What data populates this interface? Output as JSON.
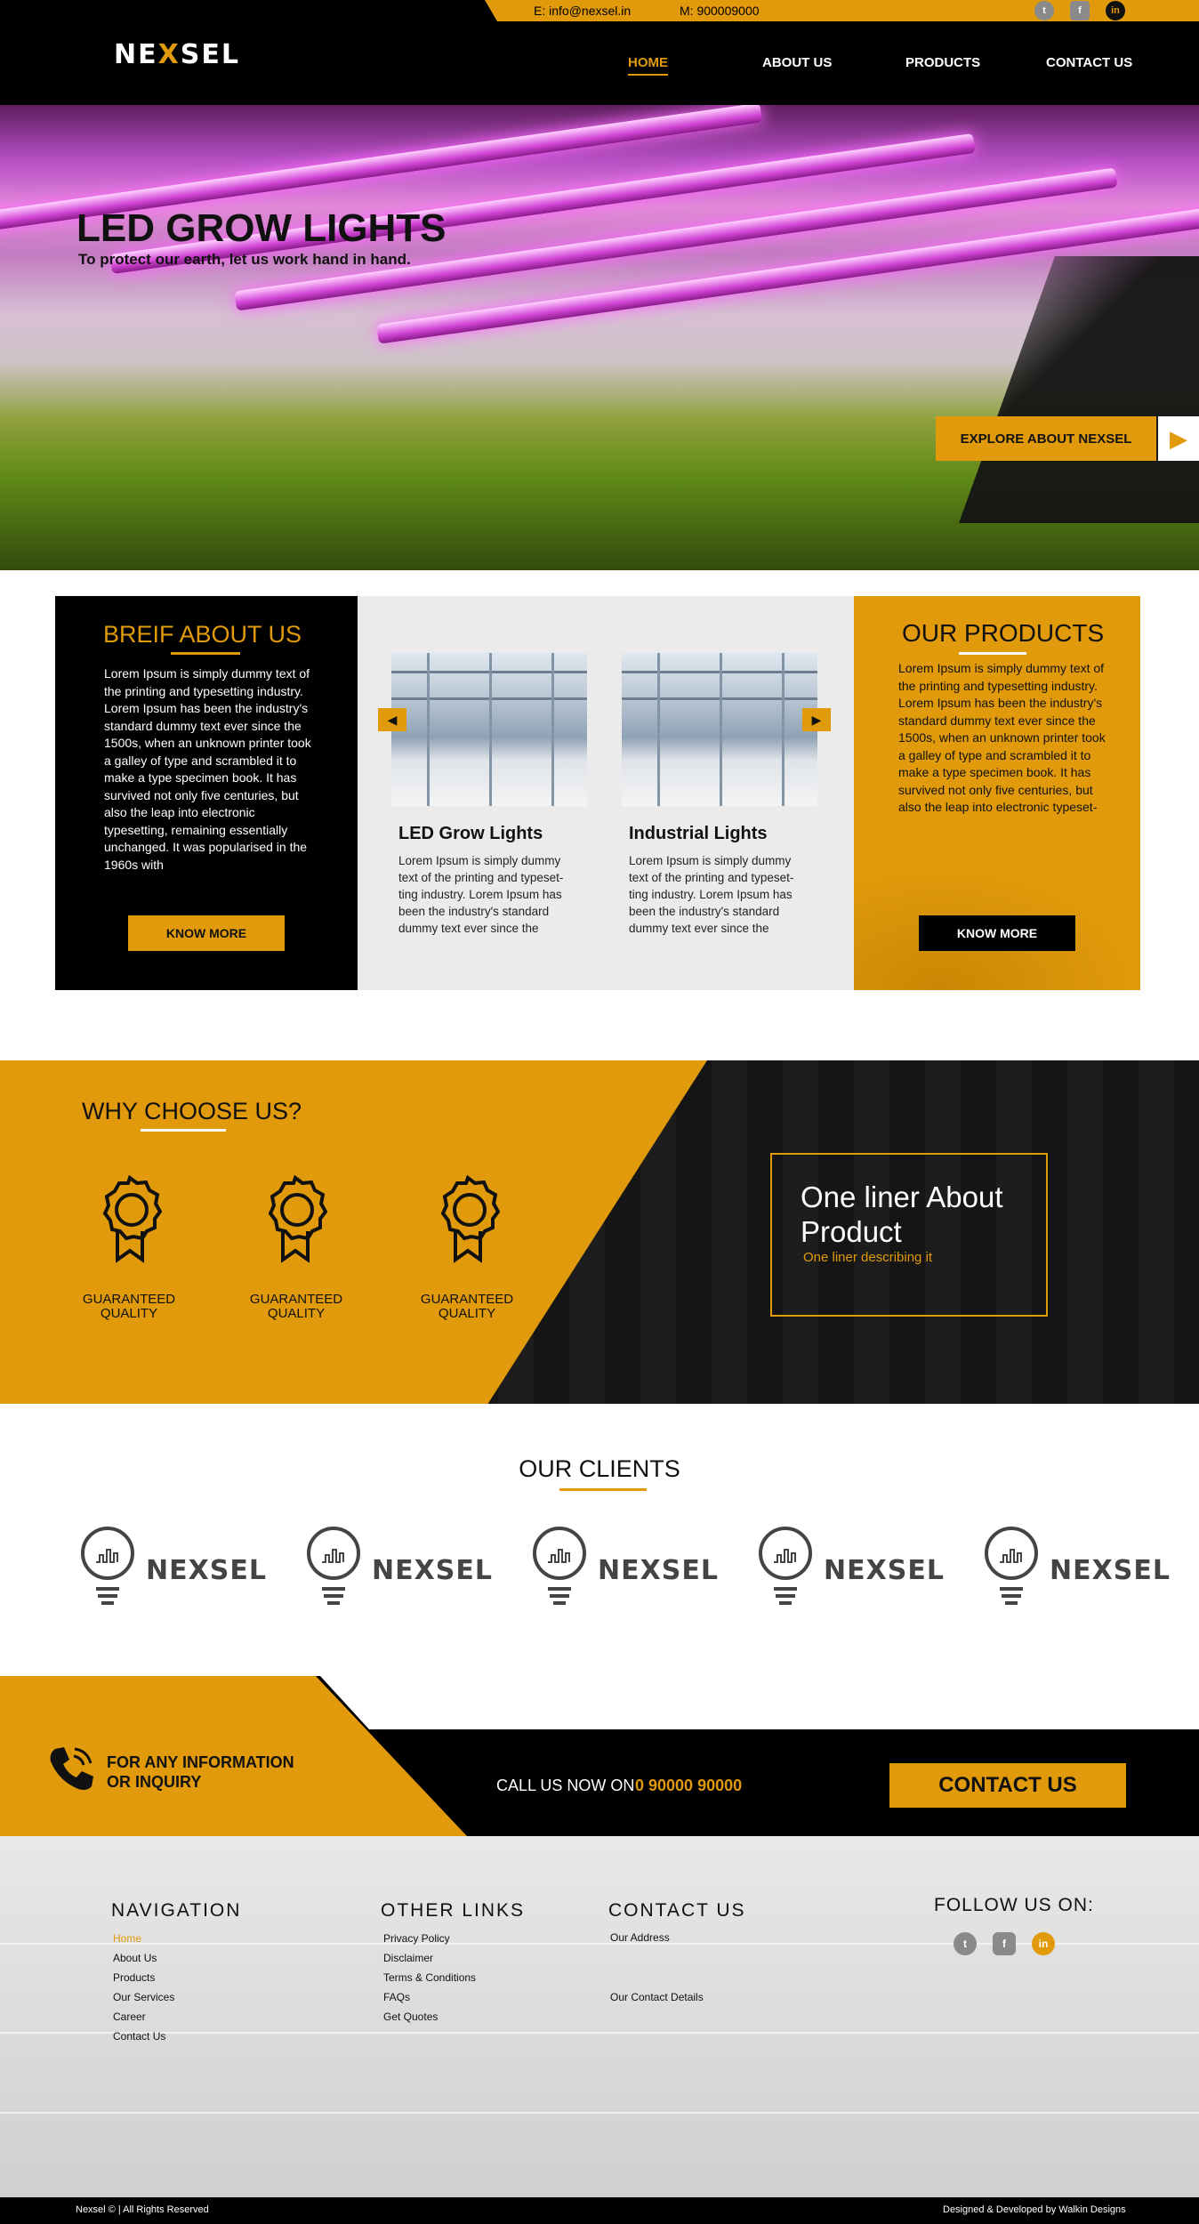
{
  "topbar": {
    "email": "E: info@nexsel.in",
    "phone": "M: 900009000"
  },
  "brand": {
    "logo_a": "NE",
    "logo_x": "X",
    "logo_b": "SEL"
  },
  "nav": {
    "home": "HOME",
    "about": "ABOUT US",
    "products": "PRODUCTS",
    "contact": "CONTACT US"
  },
  "hero": {
    "title": "LED GROW LIGHTS",
    "subtitle": "To protect our earth, let us work hand in hand.",
    "explore": "EXPLORE ABOUT NEXSEL"
  },
  "about": {
    "title": "BREIF ABOUT US",
    "text": "Lorem Ipsum is simply dummy text of the printing and typesetting industry. Lorem Ipsum has been the industry's standard dummy text ever since the 1500s, when an unknown printer took a galley of type and scrambled it to make a type specimen book. It has survived not only five centuries, but also the leap into electronic typesetting, remaining essentially unchanged. It was popularised in the 1960s with",
    "button": "KNOW MORE"
  },
  "products": [
    {
      "name": "LED Grow Lights",
      "text": "Lorem Ipsum is simply dummy text of the printing and typeset-ting industry. Lorem Ipsum has been the industry's standard dummy text ever since the"
    },
    {
      "name": "Industrial Lights",
      "text": "Lorem Ipsum is simply dummy text of the printing and typeset-ting industry. Lorem Ipsum has been the industry's standard dummy text ever since the"
    }
  ],
  "our_products": {
    "title": "OUR PRODUCTS",
    "text": "Lorem Ipsum is simply dummy text of the printing and typesetting industry. Lorem Ipsum has been the industry's standard dummy text ever since the 1500s, when an unknown printer took a galley of type and scrambled it to make a type specimen book. It has survived not only five centuries, but also the leap into electronic typeset-",
    "button": "KNOW MORE"
  },
  "why": {
    "title": "WHY CHOOSE US?",
    "badges": [
      "GUARANTEED QUALITY",
      "GUARANTEED QUALITY",
      "GUARANTEED QUALITY"
    ],
    "oneliner_title": "One liner About Product",
    "oneliner_sub": "One liner describing it"
  },
  "clients": {
    "title": "OUR CLIENTS",
    "names": [
      "NEXSEL",
      "NEXSEL",
      "NEXSEL",
      "NEXSEL",
      "NEXSEL"
    ]
  },
  "cta": {
    "info_line1": "FOR ANY INFORMATION",
    "info_line2": "OR INQUIRY",
    "callnow": "CALL US NOW ON",
    "number": "0 90000 90000",
    "button": "CONTACT US"
  },
  "footer": {
    "nav_title": "NAVIGATION",
    "nav_links": [
      "Home",
      "About Us",
      "Products",
      "Our Services",
      "Career",
      "Contact Us"
    ],
    "other_title": "OTHER LINKS",
    "other_links": [
      "Privacy Policy",
      "Disclaimer",
      "Terms & Conditions",
      "FAQs",
      "Get Quotes"
    ],
    "contact_title": "CONTACT US",
    "address": "Our Address",
    "details": "Our Contact Details",
    "follow_title": "FOLLOW US ON:",
    "copyright": "Nexsel © | All Rights Reserved",
    "designer": "Designed & Developed by Walkin Designs"
  },
  "colors": {
    "accent": "#e09a0b",
    "dark": "#000000",
    "light": "#ebebeb"
  },
  "icons": [
    "twitter-icon",
    "facebook-icon",
    "linkedin-icon",
    "play-arrow-icon",
    "chevron-left-icon",
    "chevron-right-icon",
    "award-badge-icon",
    "bulb-logo-icon",
    "phone-icon"
  ]
}
